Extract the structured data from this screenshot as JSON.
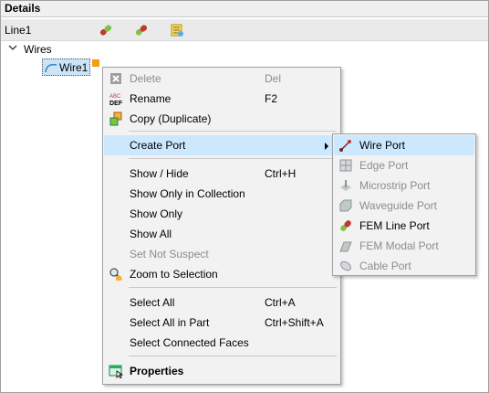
{
  "panel": {
    "title": "Details"
  },
  "object": {
    "name": "Line1"
  },
  "tree": {
    "group": "Wires",
    "item": "Wire1"
  },
  "menu": {
    "items": [
      {
        "label": "Delete",
        "shortcut": "Del",
        "disabled": true,
        "icon": "delete-icon"
      },
      {
        "label": "Rename",
        "shortcut": "F2",
        "disabled": false,
        "icon": "rename-icon"
      },
      {
        "label": "Copy (Duplicate)",
        "shortcut": "",
        "disabled": false,
        "icon": "copy-icon"
      },
      {
        "label": "Create Port",
        "shortcut": "",
        "disabled": false,
        "icon": "",
        "highlighted": true,
        "submenu": true
      },
      {
        "label": "Show / Hide",
        "shortcut": "Ctrl+H",
        "disabled": false
      },
      {
        "label": "Show Only in Collection",
        "shortcut": "",
        "disabled": false
      },
      {
        "label": "Show Only",
        "shortcut": "",
        "disabled": false
      },
      {
        "label": "Show All",
        "shortcut": "",
        "disabled": false
      },
      {
        "label": "Set Not Suspect",
        "shortcut": "",
        "disabled": true
      },
      {
        "label": "Zoom to Selection",
        "shortcut": "",
        "disabled": false,
        "icon": "zoom-icon"
      },
      {
        "label": "Select All",
        "shortcut": "Ctrl+A",
        "disabled": false
      },
      {
        "label": "Select All in Part",
        "shortcut": "Ctrl+Shift+A",
        "disabled": false
      },
      {
        "label": "Select Connected Faces",
        "shortcut": "",
        "disabled": false
      },
      {
        "label": "Properties",
        "shortcut": "",
        "disabled": false,
        "bold": true,
        "icon": "properties-icon"
      }
    ]
  },
  "submenu": {
    "items": [
      {
        "label": "Wire Port",
        "disabled": false,
        "highlighted": true,
        "icon": "wire-port-icon"
      },
      {
        "label": "Edge Port",
        "disabled": true,
        "icon": "edge-port-icon"
      },
      {
        "label": "Microstrip Port",
        "disabled": true,
        "icon": "microstrip-port-icon"
      },
      {
        "label": "Waveguide Port",
        "disabled": true,
        "icon": "waveguide-port-icon"
      },
      {
        "label": "FEM Line Port",
        "disabled": false,
        "icon": "fem-line-port-icon"
      },
      {
        "label": "FEM Modal Port",
        "disabled": true,
        "icon": "fem-modal-port-icon"
      },
      {
        "label": "Cable Port",
        "disabled": true,
        "icon": "cable-port-icon"
      }
    ]
  }
}
